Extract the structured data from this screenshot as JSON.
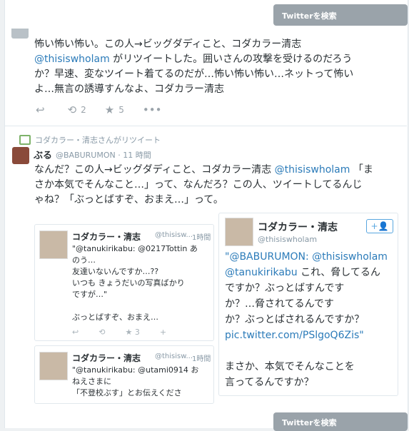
{
  "search": {
    "label": "Twitterを検索"
  },
  "tweet1": {
    "line1": "怖い怖い怖い。この人→ビッグダディこと、コダカラー清志",
    "line2_mention": "@thisiswholam",
    "line2_rest": " がリツイートした。囲いさんの攻撃を受けるのだろう",
    "line3": "か？早速、変なツイート着てるのだが…怖い怖い怖い…ネットって怖い",
    "line4": "よ…無言の誘導すんなよ、コダカラー清志",
    "retweets": "2",
    "favorites": "5"
  },
  "tweet2": {
    "rt_label": "コダカラー・清志さんがリツイート",
    "name": "ぶる",
    "handle": "@BABURUMON · 11 時間",
    "line1_a": "なんだ？この人→ビッグダディこと、コダカラー清志 ",
    "line1_mention": "@thisiswholam",
    "line1_b": " 「ま",
    "line2": "さか本気でそんなこと…」って、なんだろ？この人、ツイートしてるんじ",
    "line3": "ゃね？「ぶっとばすぞ、おまえ…」って。"
  },
  "quote1": {
    "name": "コダカラー・清志",
    "handle": "@thisisw...",
    "time": "1時間",
    "line1": "\"@tanukirikabu: @0217Tottin あ",
    "line2": "のう…",
    "line3": "友達いないんですか…??",
    "line4": "いつも きょうだいの写真ばかり",
    "line5": "ですが…\"",
    "line6": "ぶっとばすぞ、おまえ…",
    "fav_count": "3"
  },
  "quote2": {
    "name": "コダカラー・清志",
    "handle": "@thisisw...",
    "time": "1時間",
    "line1": "\"@tanukirikabu: @utami0914 お",
    "line2": "ねえさまに",
    "line3": "「不登校ぶす」とお伝えくださ"
  },
  "quote3": {
    "name": "コダカラー・清志",
    "handle": "@thisiswholam",
    "follow_label": "+👤",
    "line1": "\"@BABURUMON: @thisiswholam",
    "line2_mention": "@tanukirikabu",
    "line2_rest": " これ、脅してるん",
    "line3": "ですか？ぶっとばすんです",
    "line4": "か？…脅されてるんです",
    "line5": "か？ぶっとばされるんですか？",
    "line6": "pic.twitter.com/PSlgoQ6Zis\"",
    "line7": "まさか、本気でそんなことを",
    "line8": "言ってるんですか？"
  }
}
